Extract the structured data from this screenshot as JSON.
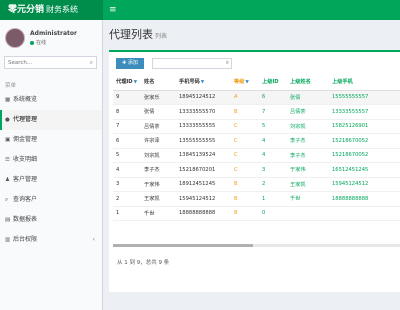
{
  "brand": {
    "bold": "零元分销",
    "name": "财务系统"
  },
  "header": {
    "menu_icon": "hamburger-icon"
  },
  "user": {
    "name": "Administrator",
    "status": "在线"
  },
  "sidebar": {
    "search_placeholder": "Search...",
    "section": "菜单",
    "items": [
      {
        "label": "系统概览",
        "icon": "dashboard-icon"
      },
      {
        "label": "代理管理",
        "icon": "user-icon"
      },
      {
        "label": "佣金管理",
        "icon": "money-icon"
      },
      {
        "label": "收支明细",
        "icon": "list-icon"
      },
      {
        "label": "客户管理",
        "icon": "users-icon"
      },
      {
        "label": "查询客户",
        "icon": "search-icon"
      },
      {
        "label": "数据报表",
        "icon": "chart-icon"
      },
      {
        "label": "后台权限",
        "icon": "lock-icon"
      }
    ]
  },
  "page": {
    "title": "代理列表",
    "subtitle": "列表"
  },
  "toolbar": {
    "add_label": "✚ 添加",
    "search_value": ""
  },
  "table": {
    "columns": [
      "代理ID",
      "姓名",
      "手机号码",
      "等级",
      "上级ID",
      "上级姓名",
      "上级手机"
    ],
    "rows": [
      [
        "9",
        "张家乐",
        "18945124512",
        "A",
        "6",
        "张倩",
        "15555555557"
      ],
      [
        "8",
        "张倩",
        "13333555570",
        "B",
        "7",
        "吕倩茶",
        "13333555557"
      ],
      [
        "7",
        "吕倩茶",
        "13333555555",
        "C",
        "5",
        "刘宗凯",
        "15825126901"
      ],
      [
        "6",
        "许宗泽",
        "13555555555",
        "C",
        "4",
        "李子杰",
        "15218670052"
      ],
      [
        "5",
        "刘宗凯",
        "13845139524",
        "C",
        "4",
        "李子杰",
        "15218670052"
      ],
      [
        "4",
        "李子杰",
        "15218670201",
        "C",
        "3",
        "于家伟",
        "16512451245"
      ],
      [
        "3",
        "于家伟",
        "18912451245",
        "B",
        "2",
        "王家凯",
        "15945124512"
      ],
      [
        "2",
        "王家凯",
        "15945124512",
        "B",
        "1",
        "千世",
        "18888888888"
      ],
      [
        "1",
        "千世",
        "18888888888",
        "B",
        "0",
        "",
        ""
      ]
    ]
  },
  "pager": {
    "text": "从 1 到 9，总共 9 条"
  }
}
